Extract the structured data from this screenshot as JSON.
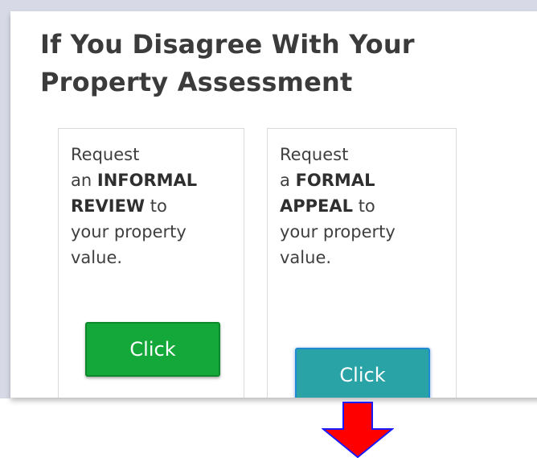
{
  "panel": {
    "heading_line1": "If You Disagree With Your",
    "heading_line2": "Property Assessment"
  },
  "cards": [
    {
      "prefix": "Request",
      "article": "an",
      "bold_line1": "INFORMAL",
      "bold_line2": "REVIEW",
      "after_bold": "to",
      "rest_line1": "your property",
      "rest_line2": "value.",
      "button_label": "Click"
    },
    {
      "prefix": "Request",
      "article": "a",
      "bold_line1": "FORMAL",
      "bold_line2": "APPEAL",
      "after_bold": "to",
      "rest_line1": "your property",
      "rest_line2": "value.",
      "button_label": "Click"
    }
  ],
  "colors": {
    "green_button": "#14a83a",
    "teal_button": "#2aa3a7",
    "arrow": "#ff0000",
    "arrow_outline": "#1a1aff"
  },
  "annotation": {
    "icon": "red-down-arrow-icon"
  }
}
